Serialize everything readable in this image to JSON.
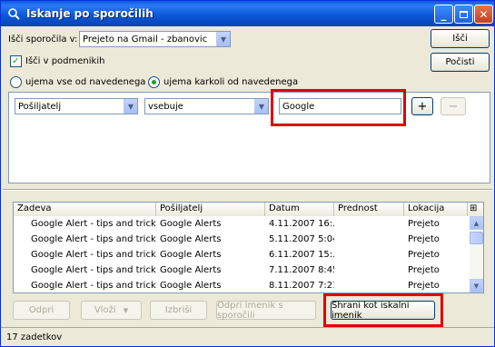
{
  "window": {
    "title": "Iskanje po sporočilih",
    "icon": "search-app-icon"
  },
  "top": {
    "search_in_label": "Išči sporočila v:",
    "search_in_value": "Prejeto na Gmail - zbanovic",
    "subfolders_label": "Išči v podmenikih",
    "subfolders_checked": true,
    "match_all_label": "ujema vse od navedenega",
    "match_any_label": "ujema karkoli od navedenega",
    "search_button": "Išči",
    "clear_button": "Počisti"
  },
  "criteria": {
    "field": "Pošiljatelj",
    "operator": "vsebuje",
    "value": "Google",
    "add": "+",
    "remove": "−"
  },
  "results": {
    "columns": [
      "Zadeva",
      "Pošiljatelj",
      "Datum",
      "Prednost",
      "Lokacija"
    ],
    "rows": [
      {
        "subject": "Google Alert - tips and tricks",
        "sender": "Google Alerts",
        "date": "4.11.2007 16:...",
        "priority": "",
        "location": "Prejeto"
      },
      {
        "subject": "Google Alert - tips and tricks",
        "sender": "Google Alerts",
        "date": "5.11.2007 5:04",
        "priority": "",
        "location": "Prejeto"
      },
      {
        "subject": "Google Alert - tips and tricks",
        "sender": "Google Alerts",
        "date": "6.11.2007 15:...",
        "priority": "",
        "location": "Prejeto"
      },
      {
        "subject": "Google Alert - tips and tricks",
        "sender": "Google Alerts",
        "date": "7.11.2007 8:45",
        "priority": "",
        "location": "Prejeto"
      },
      {
        "subject": "Google Alert - tips and tricks",
        "sender": "Google Alerts",
        "date": "8.11.2007 7:21",
        "priority": "",
        "location": "Prejeto"
      }
    ]
  },
  "actions": {
    "open": "Odpri",
    "file": "Vloži",
    "delete": "Izbriši",
    "open_folder": "Odpri imenik s sporočili",
    "save_as_search_folder": "Shrani kot iskalni imenik"
  },
  "status": {
    "count": "17 zadetkov"
  },
  "colors": {
    "highlight": "#e00000",
    "titlebar": "#0a58e0"
  }
}
